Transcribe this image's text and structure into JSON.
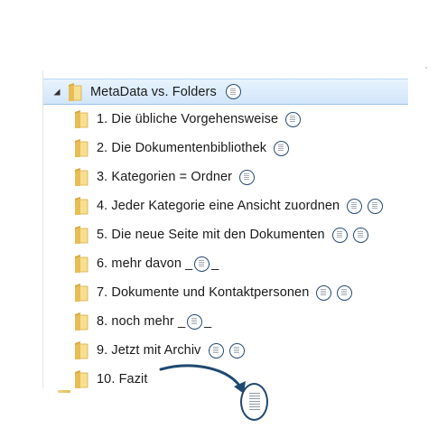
{
  "tree": {
    "root": {
      "label": "MetaData vs. Folders",
      "expanded": true,
      "icon": "folder-open-icon",
      "thumbs": 1
    },
    "items": [
      {
        "label": "1. Die übliche Vorgehensweise",
        "thumbs": 1
      },
      {
        "label": "2. Die Dokumentenbibliothek",
        "thumbs": 1
      },
      {
        "label": "3. Kategorien = Ordner",
        "thumbs": 1
      },
      {
        "label": "4. Jeder Kategorie eine Ansicht zuordnen",
        "thumbs": 2
      },
      {
        "label": "5. Die neue Seite mit den Dokumenten",
        "thumbs": 2
      },
      {
        "label": "6. mehr davon _",
        "suffix": "_",
        "thumbs": 1,
        "inline_thumb": true
      },
      {
        "label": "7. Dokumente und Kontaktpersonen",
        "thumbs": 2
      },
      {
        "label": "8. noch mehr _",
        "suffix": "_",
        "thumbs": 1,
        "inline_thumb": true
      },
      {
        "label": "9. Jetzt mit Archiv",
        "thumbs": 2
      },
      {
        "label": "10. Fazit",
        "thumbs": 0
      }
    ]
  },
  "colors": {
    "selection_top": "#e8f3fd",
    "selection_bottom": "#d2e6fa",
    "thumb_border": "#274b74",
    "arrow": "#1f4870",
    "folder_light": "#f6dc8c",
    "folder_dark": "#d9a93a"
  },
  "icons": {
    "folder": "folder-icon",
    "expander": "expanded-triangle-icon",
    "thumbnail": "document-thumbnail-icon",
    "arrow": "curved-arrow-icon"
  }
}
